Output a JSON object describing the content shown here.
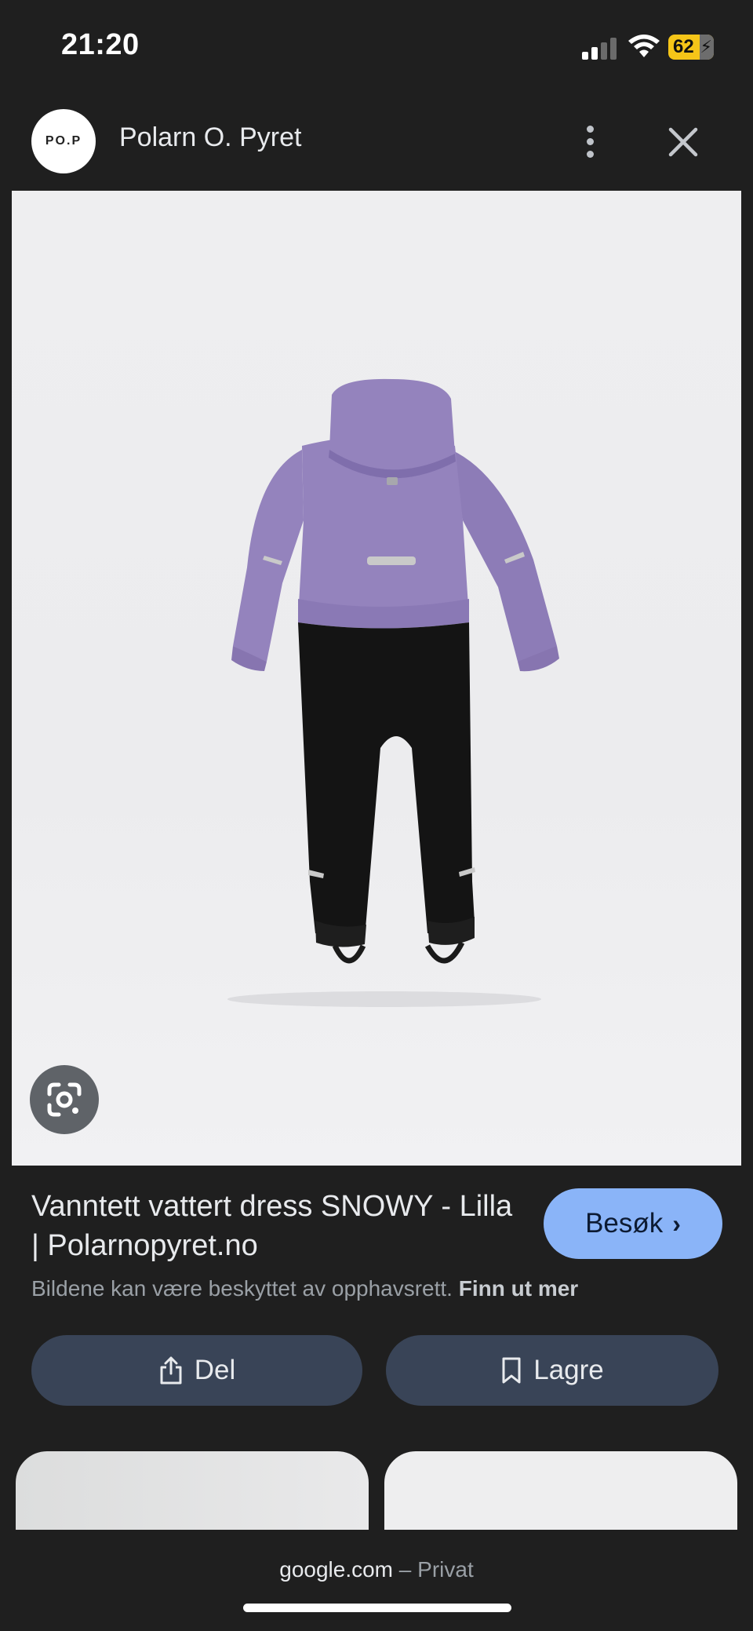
{
  "status_bar": {
    "time": "21:20",
    "battery_level": "62"
  },
  "source": {
    "logo_text": "PO.P",
    "name": "Polarn O. Pyret"
  },
  "image": {
    "product_colors": {
      "jacket": "#9483bd",
      "pants": "#141414",
      "reflector": "#c9c9c9"
    }
  },
  "result": {
    "title": "Vanntett vattert dress SNOWY - Lilla | Polarnopyret.no",
    "visit_label": "Besøk",
    "copyright_text": "Bildene kan være beskyttet av opphavsrett.",
    "learn_more": "Finn ut mer"
  },
  "actions": {
    "share_label": "Del",
    "save_label": "Lagre"
  },
  "url_bar": {
    "domain": "google.com",
    "mode": "– Privat"
  },
  "icons": {
    "more": "more-vert-icon",
    "close": "close-icon",
    "lens": "google-lens-icon",
    "share": "share-icon",
    "save": "bookmark-icon"
  },
  "colors": {
    "background": "#1f1f1f",
    "accent": "#8ab4f8",
    "pill": "#394457",
    "battery": "#f5c518"
  }
}
